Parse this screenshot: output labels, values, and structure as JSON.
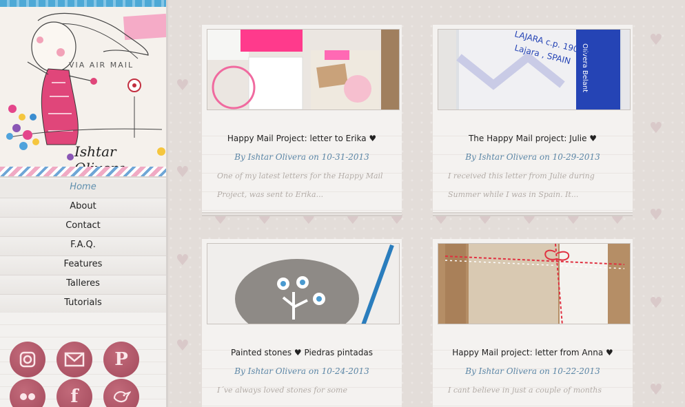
{
  "header": {
    "via_text": "VIA AIR MAIL",
    "signature": "Ishtar Olivera"
  },
  "nav": {
    "items": [
      {
        "label": "Home",
        "active": true
      },
      {
        "label": "About"
      },
      {
        "label": "Contact"
      },
      {
        "label": "F.A.Q."
      },
      {
        "label": "Features"
      },
      {
        "label": "Talleres"
      },
      {
        "label": "Tutorials"
      }
    ]
  },
  "social": {
    "icons": [
      "instagram-icon",
      "mail-icon",
      "pinterest-icon",
      "flickr-icon",
      "facebook-icon",
      "bird-icon"
    ],
    "color": "#b55b6c"
  },
  "posts": [
    {
      "title": "Happy Mail Project: letter to Erika ♥",
      "byline": "By Ishtar Olivera on 10-31-2013",
      "excerpt_1": "One of my latest letters for the Happy Mail",
      "excerpt_2": "Project, was sent to Erika..."
    },
    {
      "title": "The Happy Mail project: Julie ♥",
      "byline": "By Ishtar Olivera on 10-29-2013",
      "excerpt_1": "I received this letter from Julie during",
      "excerpt_2": "Summer while I was in Spain. It..."
    },
    {
      "title": "Painted stones ♥ Piedras pintadas",
      "byline": "By Ishtar Olivera on 10-24-2013",
      "excerpt_1": "I´ve always loved stones for some"
    },
    {
      "title": "Happy Mail project: letter from Anna ♥",
      "byline": "By Ishtar Olivera on 10-22-2013",
      "excerpt_1": "I cant believe in just a couple of months"
    }
  ],
  "colors": {
    "accent": "#5b86a6",
    "background": "#e3ddd9",
    "heart": "#d9c7c8"
  }
}
